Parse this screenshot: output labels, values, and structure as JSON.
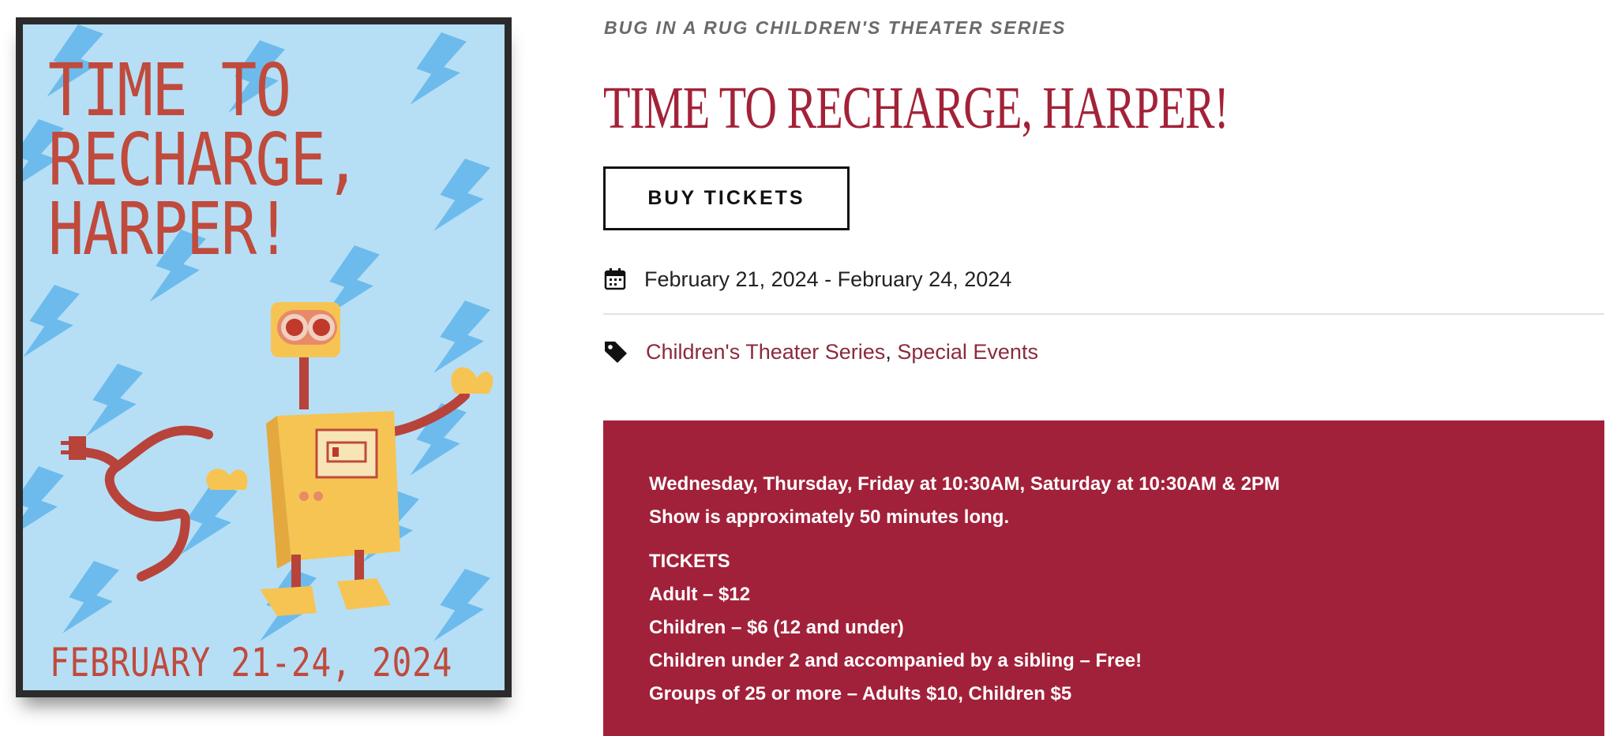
{
  "poster": {
    "title_lines": [
      "TIME TO",
      "RECHARGE,",
      "HARPER!"
    ],
    "date_text": "FEBRUARY 21-24, 2024",
    "colors": {
      "background": "#b6dff6",
      "bolts": "#5fb5ea",
      "title": "#c04a3c",
      "robot_body": "#f6c453",
      "robot_cord": "#b8433a"
    }
  },
  "event": {
    "series": "BUG IN A RUG CHILDREN'S THEATER SERIES",
    "title": "TIME TO RECHARGE, HARPER!",
    "buy_label": "BUY TICKETS",
    "date_range": "February 21, 2024 - February 24, 2024",
    "categories": [
      "Children's Theater Series",
      "Special Events"
    ],
    "category_separator": ","
  },
  "details": {
    "schedule": "Wednesday, Thursday, Friday at 10:30AM, Saturday at 10:30AM & 2PM",
    "duration": "Show is approximately 50 minutes long.",
    "tickets_heading": "TICKETS",
    "prices": [
      "Adult – $12",
      "Children – $6 (12 and under)",
      "Children under 2 and accompanied by a sibling – Free!",
      "Groups of 25 or more – Adults $10, Children $5"
    ]
  },
  "icons": {
    "calendar": "calendar-icon",
    "tag": "tag-icon"
  },
  "theme": {
    "accent": "#a2213a",
    "link": "#8b2a3c"
  }
}
